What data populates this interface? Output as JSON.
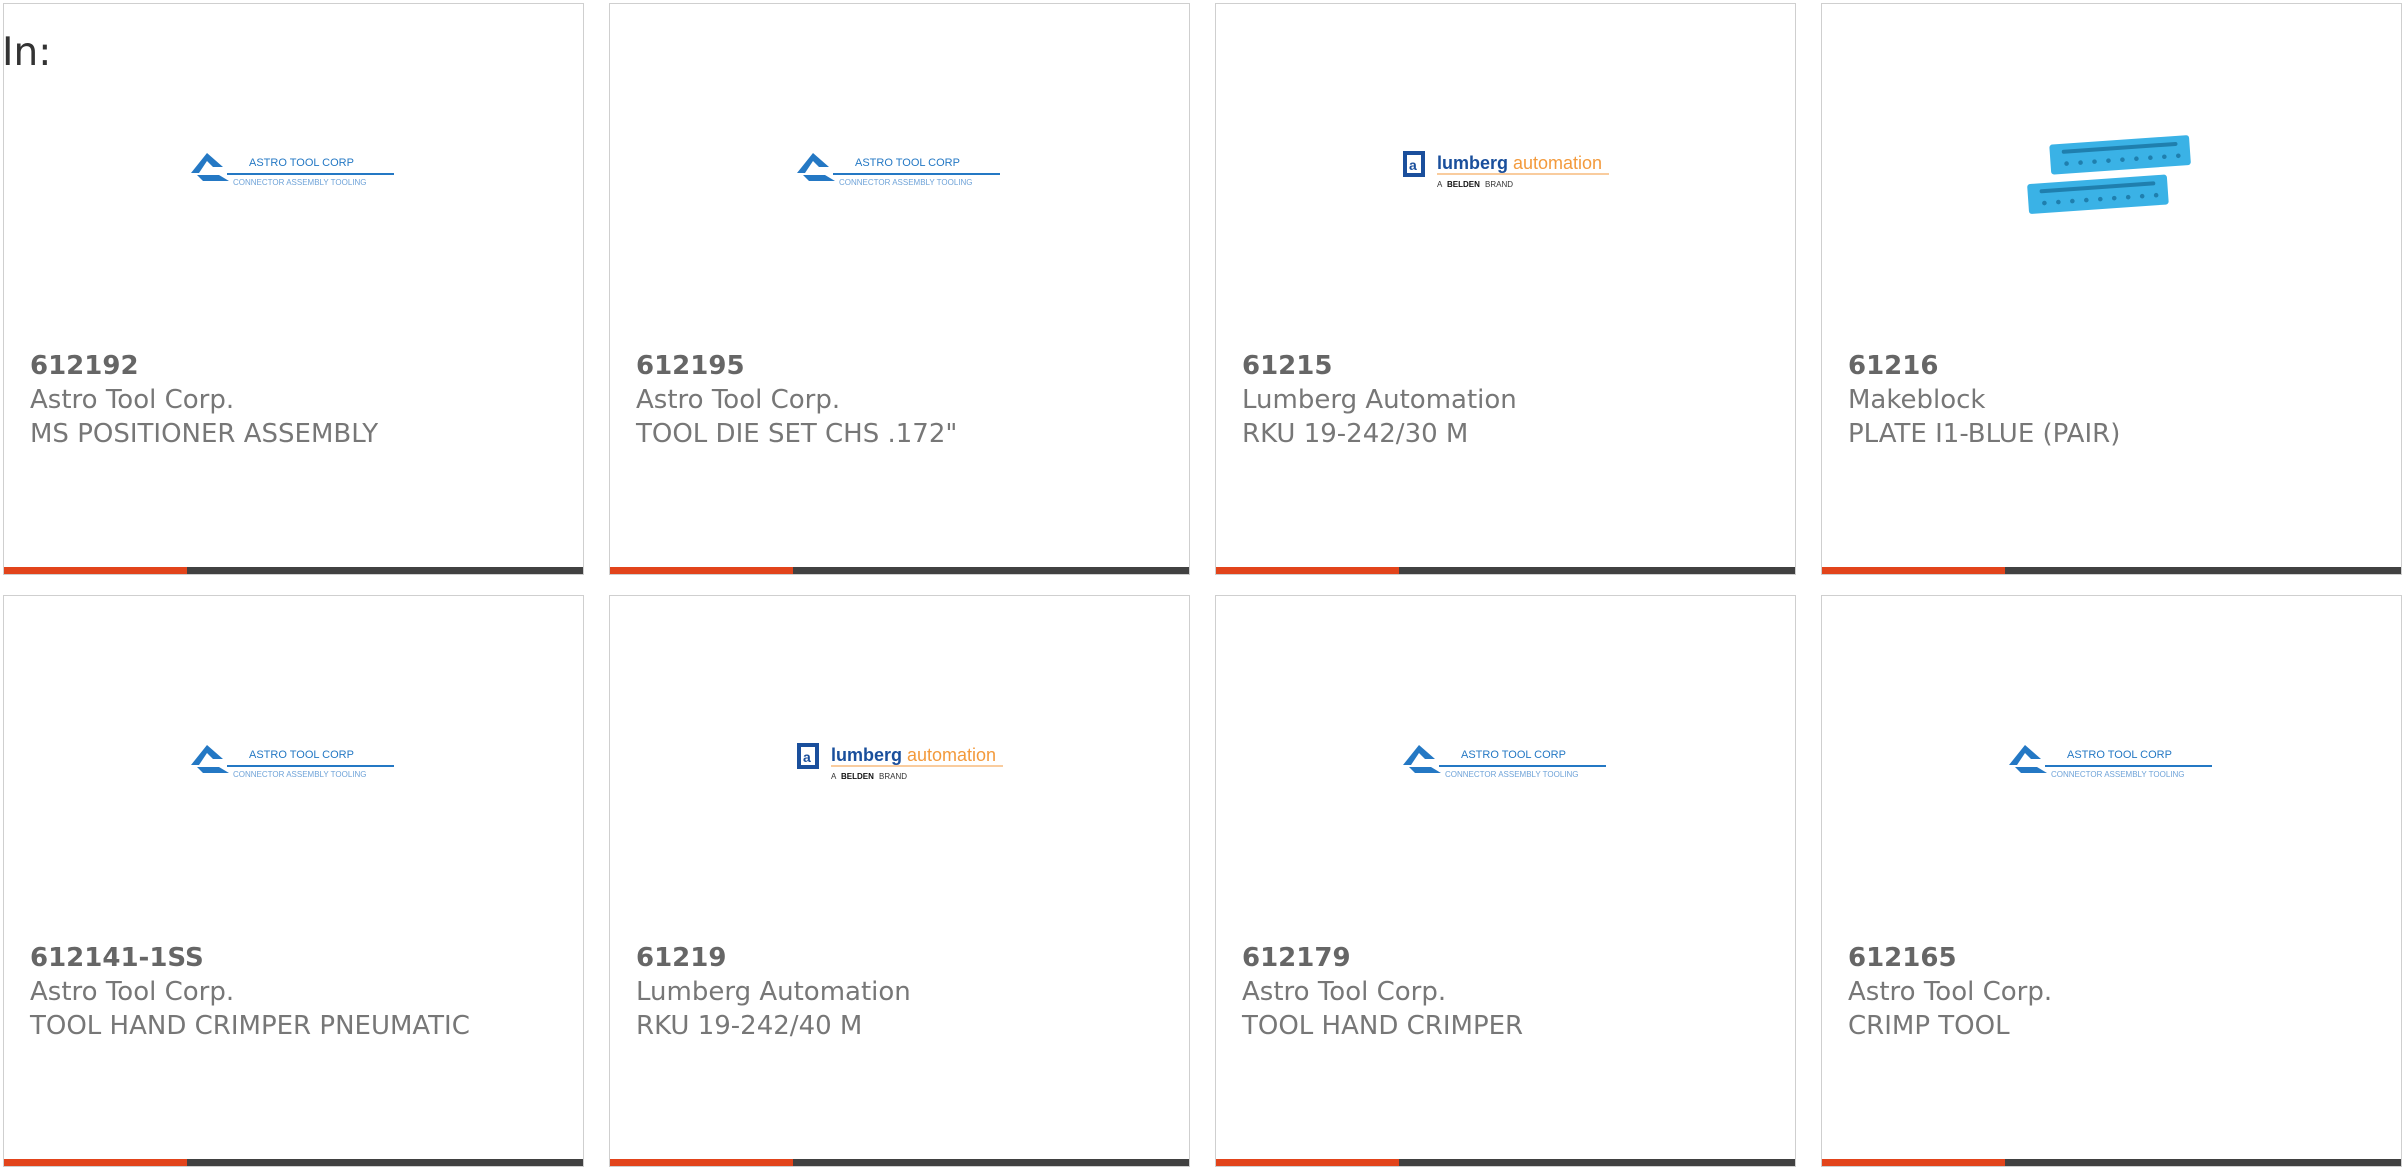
{
  "heading": "In:",
  "colors": {
    "accent": "#e2441b",
    "bar": "#414141",
    "astro_blue": "#2478c4",
    "lumberg_blue": "#1a4f9c",
    "lumberg_orange": "#f39a3c",
    "plate_blue": "#3ab2e6"
  },
  "logos": {
    "astro": {
      "name": "ASTRO TOOL CORP",
      "tagline": "CONNECTOR ASSEMBLY TOOLING"
    },
    "lumberg": {
      "name_a": "lumberg",
      "name_b": "automation",
      "tagline_pre": "A",
      "tagline_brand": "BELDEN",
      "tagline_post": "BRAND"
    }
  },
  "products": [
    {
      "part_number": "612192",
      "manufacturer": "Astro Tool Corp.",
      "description": "MS POSITIONER ASSEMBLY",
      "image": "astro-logo"
    },
    {
      "part_number": "612195",
      "manufacturer": "Astro Tool Corp.",
      "description": "TOOL DIE SET CHS .172\"",
      "image": "astro-logo"
    },
    {
      "part_number": "61215",
      "manufacturer": "Lumberg Automation",
      "description": "RKU 19-242/30 M",
      "image": "lumberg-logo"
    },
    {
      "part_number": "61216",
      "manufacturer": "Makeblock",
      "description": "PLATE I1-BLUE (PAIR)",
      "image": "blue-plate-photo"
    },
    {
      "part_number": "612141-1SS",
      "manufacturer": "Astro Tool Corp.",
      "description": "TOOL HAND CRIMPER PNEUMATIC",
      "image": "astro-logo"
    },
    {
      "part_number": "61219",
      "manufacturer": "Lumberg Automation",
      "description": "RKU 19-242/40 M",
      "image": "lumberg-logo"
    },
    {
      "part_number": "612179",
      "manufacturer": "Astro Tool Corp.",
      "description": "TOOL HAND CRIMPER",
      "image": "astro-logo"
    },
    {
      "part_number": "612165",
      "manufacturer": "Astro Tool Corp.",
      "description": "CRIMP TOOL",
      "image": "astro-logo"
    }
  ]
}
